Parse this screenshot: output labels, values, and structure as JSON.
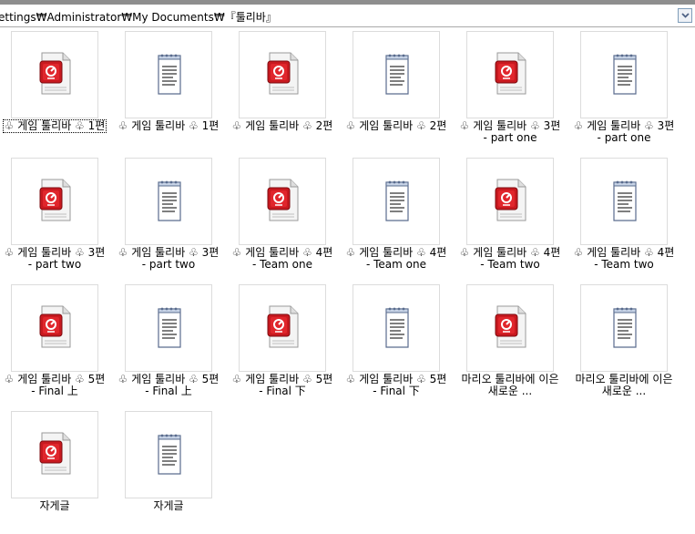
{
  "address": {
    "path": "ettings₩Administrator₩My Documents₩『툴리바』"
  },
  "items": [
    {
      "type": "media",
      "line1": "♧ 게임 툴리바 ♧ 1편",
      "line2": "",
      "selected": true
    },
    {
      "type": "text",
      "line1": "♧ 게임 툴리바 ♧ 1편",
      "line2": ""
    },
    {
      "type": "media",
      "line1": "♧ 게임 툴리바 ♧ 2편",
      "line2": ""
    },
    {
      "type": "text",
      "line1": "♧ 게임 툴리바 ♧ 2편",
      "line2": ""
    },
    {
      "type": "media",
      "line1": "♧ 게임 툴리바 ♧ 3편",
      "line2": "- part one"
    },
    {
      "type": "text",
      "line1": "♧ 게임 툴리바 ♧ 3편",
      "line2": "- part one"
    },
    {
      "type": "media",
      "line1": "♧ 게임 툴리바 ♧ 3편",
      "line2": "- part two"
    },
    {
      "type": "text",
      "line1": "♧ 게임 툴리바 ♧ 3편",
      "line2": "- part two"
    },
    {
      "type": "media",
      "line1": "♧ 게임 툴리바 ♧ 4편",
      "line2": "- Team one"
    },
    {
      "type": "text",
      "line1": "♧ 게임 툴리바 ♧ 4편",
      "line2": "- Team one"
    },
    {
      "type": "media",
      "line1": "♧ 게임 툴리바 ♧ 4편",
      "line2": "- Team two"
    },
    {
      "type": "text",
      "line1": "♧ 게임 툴리바 ♧ 4편",
      "line2": "- Team two"
    },
    {
      "type": "media",
      "line1": "♧ 게임 툴리바 ♧ 5편",
      "line2": "- Final 上"
    },
    {
      "type": "text",
      "line1": "♧ 게임 툴리바 ♧ 5편",
      "line2": "- Final 上"
    },
    {
      "type": "media",
      "line1": "♧ 게임 툴리바 ♧ 5편",
      "line2": "- Final 下"
    },
    {
      "type": "text",
      "line1": "♧ 게임 툴리바 ♧ 5편",
      "line2": "- Final 下"
    },
    {
      "type": "media",
      "line1": "마리오 툴리바에 이은",
      "line2": "새로운 ..."
    },
    {
      "type": "text",
      "line1": "마리오 툴리바에 이은",
      "line2": "새로운 ..."
    },
    {
      "type": "media",
      "line1": "자게글",
      "line2": ""
    },
    {
      "type": "text",
      "line1": "자게글",
      "line2": ""
    }
  ]
}
